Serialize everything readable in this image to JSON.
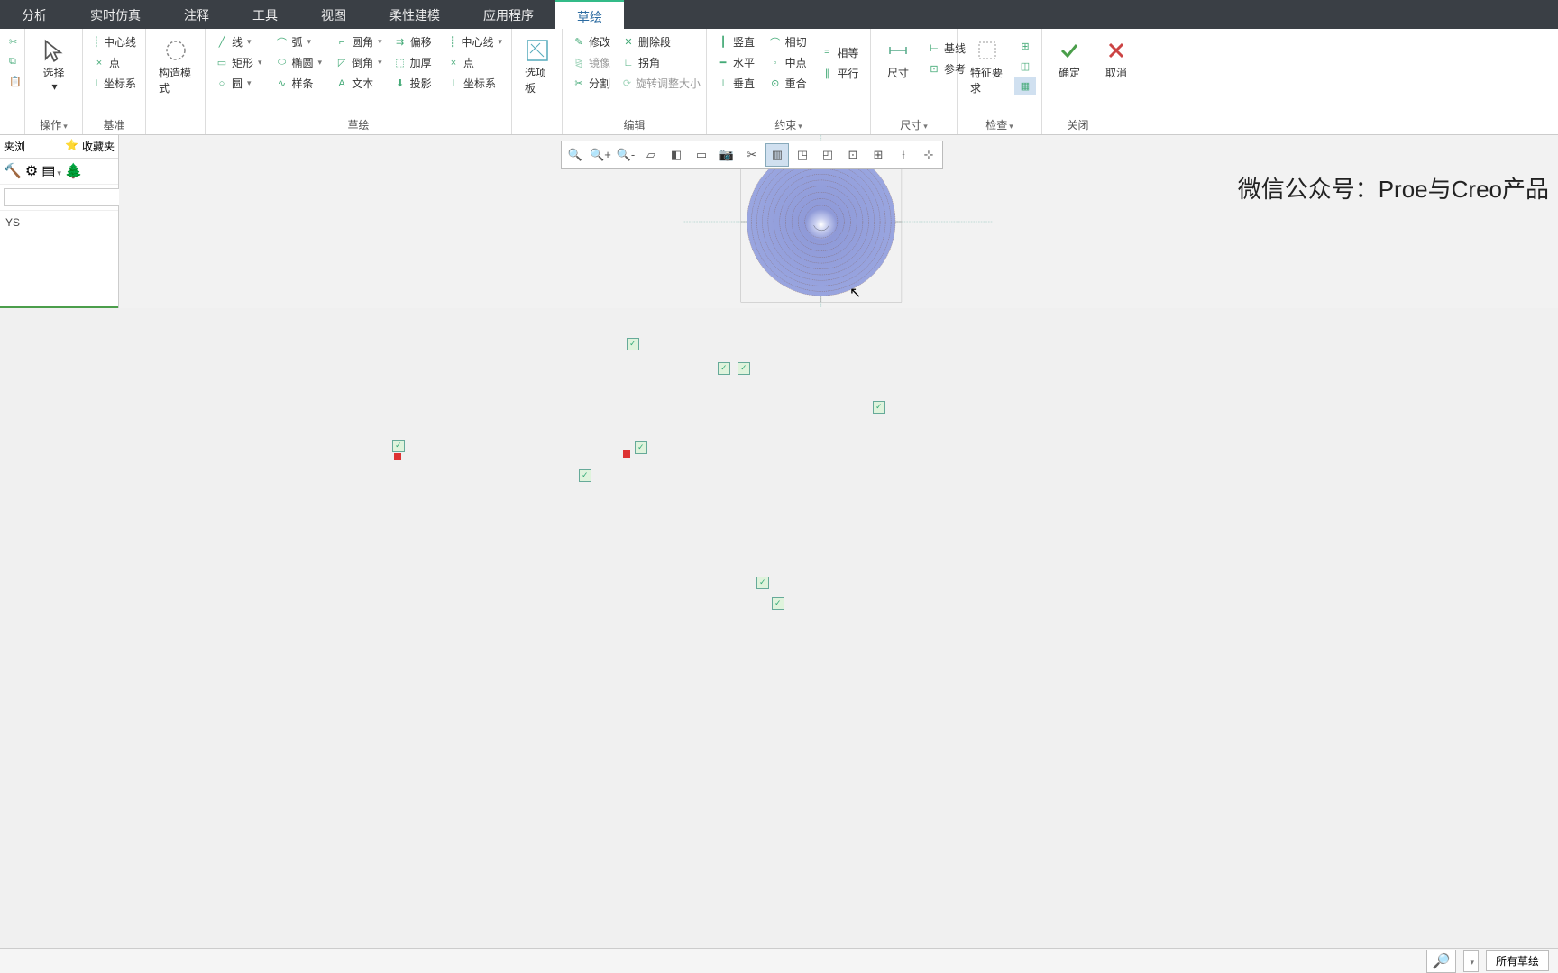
{
  "tabs": {
    "analysis": "分析",
    "realtime": "实时仿真",
    "annotation": "注释",
    "tool": "工具",
    "view": "视图",
    "flex": "柔性建模",
    "app": "应用程序",
    "sketch": "草绘"
  },
  "ribbon": {
    "select": "选择",
    "ops": "操作",
    "datum": "基准",
    "sketch": "草绘",
    "edit": "编辑",
    "constraint": "约束",
    "dimension": "尺寸",
    "inspect": "检查",
    "close": "关闭",
    "centerline": "中心线",
    "point": "点",
    "csys": "坐标系",
    "construct_mode": "构造模式",
    "line": "线",
    "rect": "矩形",
    "circle": "圆",
    "arc": "弧",
    "ellipse": "椭圆",
    "spline": "样条",
    "fillet": "圆角",
    "chamfer": "倒角",
    "text": "文本",
    "offset": "偏移",
    "thicken": "加厚",
    "projection": "投影",
    "centerline2": "中心线",
    "point2": "点",
    "csys2": "坐标系",
    "options": "选项板",
    "modify": "修改",
    "mirror": "镜像",
    "split": "分割",
    "delete": "删除段",
    "corner": "拐角",
    "rotresize": "旋转调整大小",
    "vertical": "竖直",
    "horizontal": "水平",
    "perp": "垂直",
    "tangent": "相切",
    "midpoint": "中点",
    "coincident": "重合",
    "equal": "相等",
    "parallel": "平行",
    "dim_btn": "尺寸",
    "baseline": "基线",
    "reference": "参考",
    "feature_req": "特征要求",
    "ok": "确定",
    "cancel": "取消"
  },
  "leftpanel": {
    "browse": "夹浏",
    "fav": "收藏夹",
    "tree_item": "YS"
  },
  "watermark": "微信公众号：Proe与Creo产品",
  "status": {
    "filter": "所有草绘"
  }
}
